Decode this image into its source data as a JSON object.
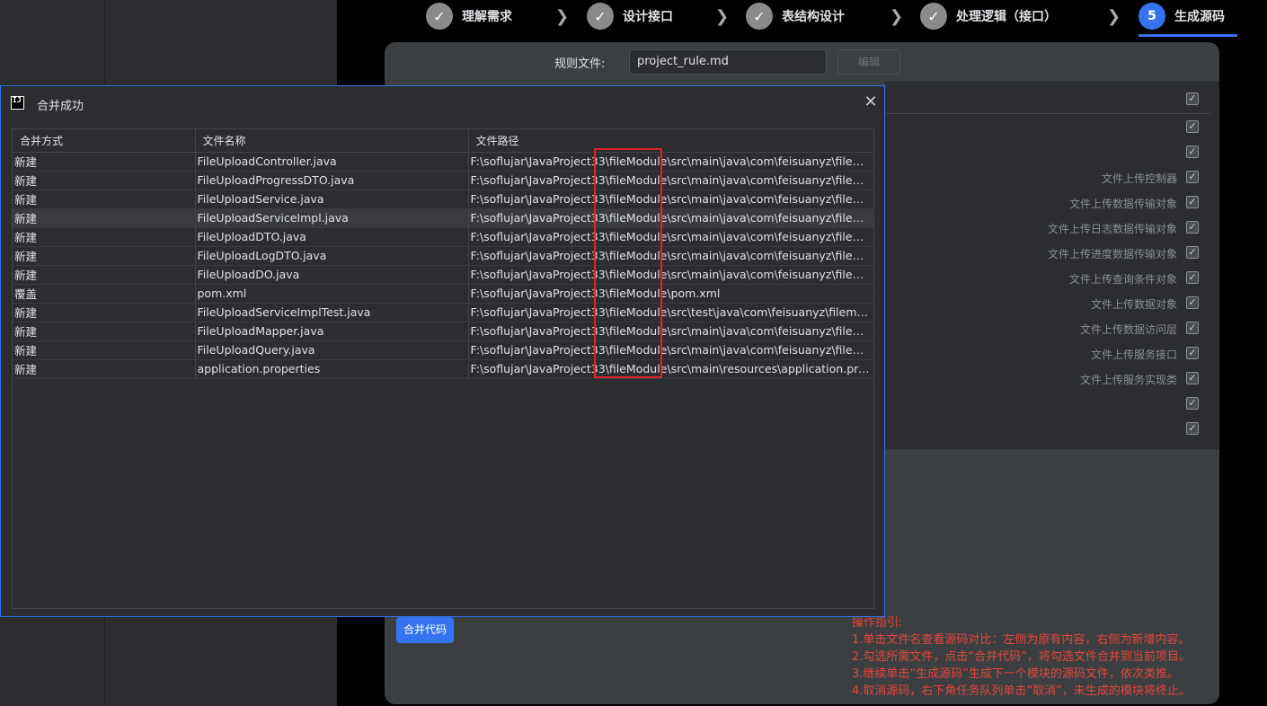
{
  "stepper": {
    "steps": [
      {
        "label": "理解需求",
        "icon": "✓"
      },
      {
        "label": "设计接口",
        "icon": "✓"
      },
      {
        "label": "表结构设计",
        "icon": "✓"
      },
      {
        "label": "处理逻辑（接口）",
        "icon": "✓"
      },
      {
        "label": "生成源码",
        "icon": "5"
      }
    ],
    "active_color": "#3574f0",
    "done_color": "#8a8a8a"
  },
  "rule": {
    "label": "规则文件:",
    "value": "project_rule.md",
    "edit_label": "编辑"
  },
  "right_list": {
    "items": [
      "文件上传控制器",
      "文件上传数据传输对象",
      "文件上传日志数据传输对象",
      "文件上传进度数据传输对象",
      "文件上传查询条件对象",
      "文件上传数据对象",
      "文件上传数据访问层",
      "文件上传服务接口",
      "文件上传服务实现类"
    ]
  },
  "merge_button": "合并代码",
  "guide": {
    "title": "操作指引:",
    "lines": [
      "1.单击文件名查看源码对比：左侧为原有内容，右侧为新增内容。",
      "2.勾选所需文件，点击“合并代码”，将勾选文件合并到当前项目。",
      "3.继续单击“生成源码”生成下一个模块的源码文件，依次类推。",
      "4.取消源码，右下角任务队列单击“取消”，未生成的模块将终止。"
    ],
    "color": "#e5453d"
  },
  "dialog": {
    "title": "合并成功",
    "logo": "IJ",
    "close": "✕",
    "columns": [
      "合并方式",
      "文件名称",
      "文件路径"
    ],
    "rows": [
      [
        "新建",
        "FileUploadController.java",
        "F:\\soflujar\\JavaProject33\\fileModule\\src\\main\\java\\com\\feisuanyz\\filemana..."
      ],
      [
        "新建",
        "FileUploadProgressDTO.java",
        "F:\\soflujar\\JavaProject33\\fileModule\\src\\main\\java\\com\\feisuanyz\\filemana..."
      ],
      [
        "新建",
        "FileUploadService.java",
        "F:\\soflujar\\JavaProject33\\fileModule\\src\\main\\java\\com\\feisuanyz\\filemana..."
      ],
      [
        "新建",
        "FileUploadServiceImpl.java",
        "F:\\soflujar\\JavaProject33\\fileModule\\src\\main\\java\\com\\feisuanyz\\filemana..."
      ],
      [
        "新建",
        "FileUploadDTO.java",
        "F:\\soflujar\\JavaProject33\\fileModule\\src\\main\\java\\com\\feisuanyz\\filemana..."
      ],
      [
        "新建",
        "FileUploadLogDTO.java",
        "F:\\soflujar\\JavaProject33\\fileModule\\src\\main\\java\\com\\feisuanyz\\filemana..."
      ],
      [
        "新建",
        "FileUploadDO.java",
        "F:\\soflujar\\JavaProject33\\fileModule\\src\\main\\java\\com\\feisuanyz\\filemana..."
      ],
      [
        "覆盖",
        "pom.xml",
        "F:\\soflujar\\JavaProject33\\fileModule\\pom.xml"
      ],
      [
        "新建",
        "FileUploadServiceImplTest.java",
        "F:\\soflujar\\JavaProject33\\fileModule\\src\\test\\java\\com\\feisuanyz\\filemanag..."
      ],
      [
        "新建",
        "FileUploadMapper.java",
        "F:\\soflujar\\JavaProject33\\fileModule\\src\\main\\java\\com\\feisuanyz\\filemana..."
      ],
      [
        "新建",
        "FileUploadQuery.java",
        "F:\\soflujar\\JavaProject33\\fileModule\\src\\main\\java\\com\\feisuanyz\\filemana..."
      ],
      [
        "新建",
        "application.properties",
        "F:\\soflujar\\JavaProject33\\fileModule\\src\\main\\resources\\application.prope..."
      ]
    ],
    "selected_row": 3,
    "highlight_color": "#e0252a"
  }
}
